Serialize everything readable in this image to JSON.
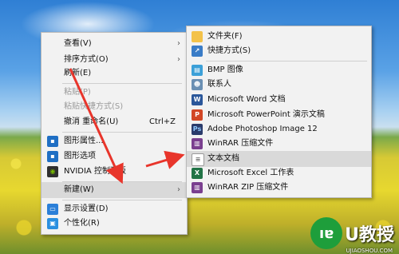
{
  "context_menu": {
    "items": [
      {
        "label": "查看(V)",
        "has_submenu": true
      },
      {
        "label": "排序方式(O)",
        "has_submenu": true
      },
      {
        "label": "刷新(E)"
      },
      {
        "label": "粘贴(P)",
        "disabled": true
      },
      {
        "label": "粘贴快捷方式(S)",
        "disabled": true
      },
      {
        "label": "撤消 重命名(U)",
        "shortcut": "Ctrl+Z"
      },
      {
        "label": "图形属性...",
        "icon": "intel-graphics-icon"
      },
      {
        "label": "图形选项",
        "icon": "intel-graphics-icon",
        "has_submenu": true
      },
      {
        "label": "NVIDIA 控制面板",
        "icon": "nvidia-icon"
      },
      {
        "label": "新建(W)",
        "has_submenu": true,
        "highlighted": true
      },
      {
        "label": "显示设置(D)",
        "icon": "display-settings-icon"
      },
      {
        "label": "个性化(R)",
        "icon": "personalize-icon"
      }
    ]
  },
  "new_submenu": {
    "items": [
      {
        "label": "文件夹(F)",
        "icon": "folder-icon"
      },
      {
        "label": "快捷方式(S)",
        "icon": "shortcut-icon"
      },
      {
        "label": "BMP 图像",
        "icon": "bmp-image-icon"
      },
      {
        "label": "联系人",
        "icon": "contact-icon"
      },
      {
        "label": "Microsoft Word 文档",
        "icon": "word-icon"
      },
      {
        "label": "Microsoft PowerPoint 演示文稿",
        "icon": "powerpoint-icon"
      },
      {
        "label": "Adobe Photoshop Image 12",
        "icon": "photoshop-icon"
      },
      {
        "label": "WinRAR 压缩文件",
        "icon": "winrar-icon"
      },
      {
        "label": "文本文档",
        "icon": "text-document-icon",
        "highlighted": true
      },
      {
        "label": "Microsoft Excel 工作表",
        "icon": "excel-icon"
      },
      {
        "label": "WinRAR ZIP 压缩文件",
        "icon": "winrar-zip-icon"
      }
    ]
  },
  "watermark": {
    "badge": "ıɐ",
    "text": "U教授",
    "url": "UJIAOSHOU.COM"
  },
  "colors": {
    "arrow": "#e8352b",
    "menu_bg": "#f2f2f2",
    "highlight": "#d9d9d9"
  }
}
